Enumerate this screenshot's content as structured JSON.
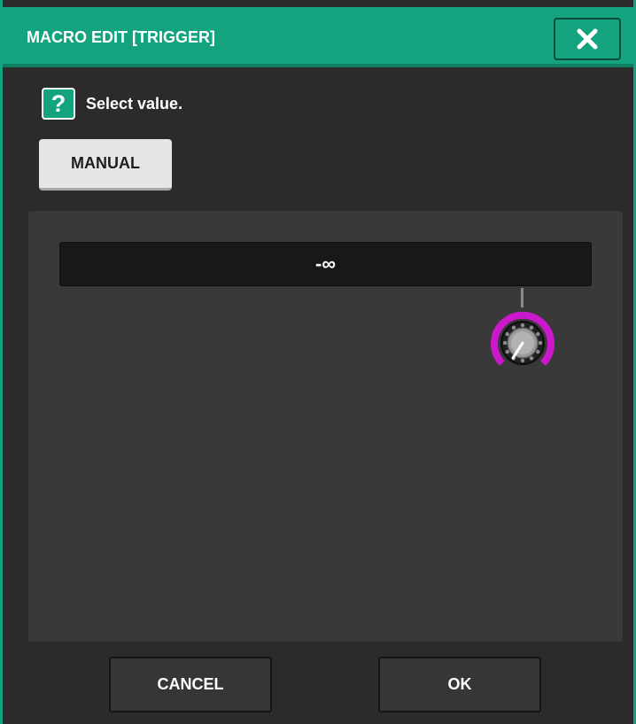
{
  "dialog": {
    "title": "MACRO EDIT [TRIGGER]",
    "close_icon": "close-icon",
    "accent_color": "#14a37f"
  },
  "help": {
    "icon": "question-icon",
    "icon_glyph": "?",
    "text": "Select value."
  },
  "mode": {
    "manual_label": "MANUAL"
  },
  "parameter": {
    "value": "-∞",
    "knob_icon": "rotary-knob-icon",
    "knob_ring_color": "#cc18cc"
  },
  "footer": {
    "cancel_label": "CANCEL",
    "ok_label": "OK"
  }
}
